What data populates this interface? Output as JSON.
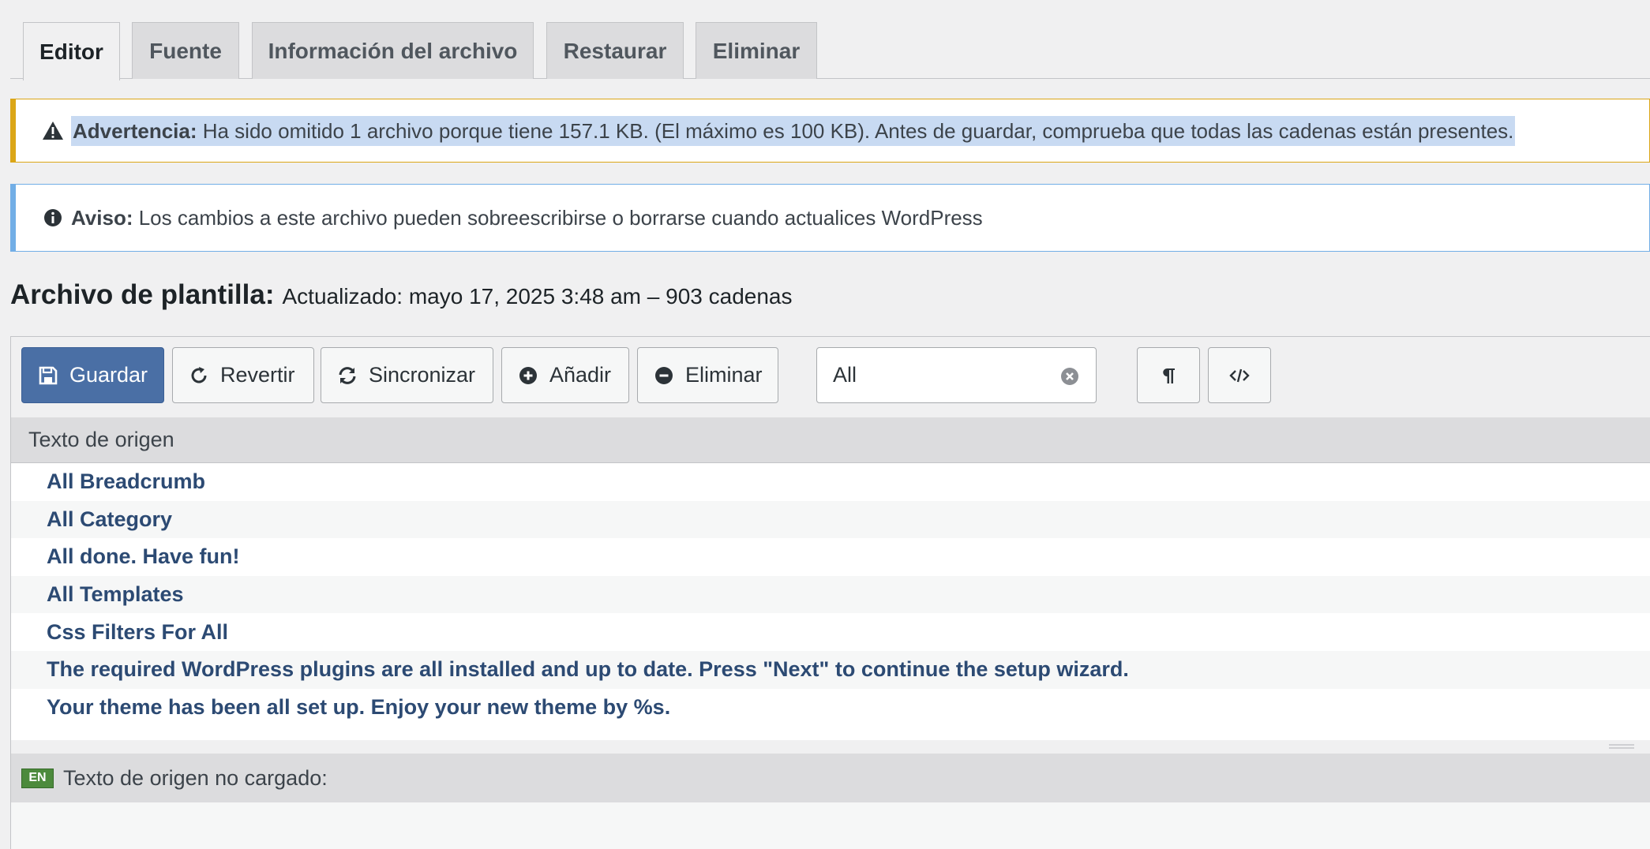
{
  "tabs": [
    {
      "label": "Editor",
      "active": true
    },
    {
      "label": "Fuente",
      "active": false
    },
    {
      "label": "Información del archivo",
      "active": false
    },
    {
      "label": "Restaurar",
      "active": false
    },
    {
      "label": "Eliminar",
      "active": false
    }
  ],
  "notices": {
    "warning": {
      "icon": "warning-triangle-icon",
      "label": "Advertencia:",
      "text": " Ha sido omitido 1 archivo porque tiene 157.1 KB. (El máximo es 100 KB). Antes de guardar, comprueba que todas las cadenas están presentes.",
      "color": "#dba617"
    },
    "info": {
      "icon": "info-circle-icon",
      "label": "Aviso:",
      "text": " Los cambios a este archivo pueden sobreescribirse o borrarse cuando actualices WordPress",
      "color": "#72aee6"
    }
  },
  "file": {
    "heading": "Archivo de plantilla:",
    "meta": "Actualizado: mayo 17, 2025 3:48 am – 903 cadenas"
  },
  "toolbar": {
    "save_label": "Guardar",
    "revert_label": "Revertir",
    "sync_label": "Sincronizar",
    "add_label": "Añadir",
    "delete_label": "Eliminar",
    "search_value": "All",
    "primary_color": "#4a6fa5"
  },
  "list": {
    "header": "Texto de origen",
    "rows": [
      "All Breadcrumb",
      "All Category",
      "All done. Have fun!",
      "All Templates",
      "Css Filters For All",
      "The required WordPress plugins are all installed and up to date. Press \"Next\" to continue the setup wizard.",
      "Your theme has been all set up. Enjoy your new theme by %s."
    ]
  },
  "source": {
    "flag": "EN",
    "label": "Texto de origen no cargado:"
  }
}
